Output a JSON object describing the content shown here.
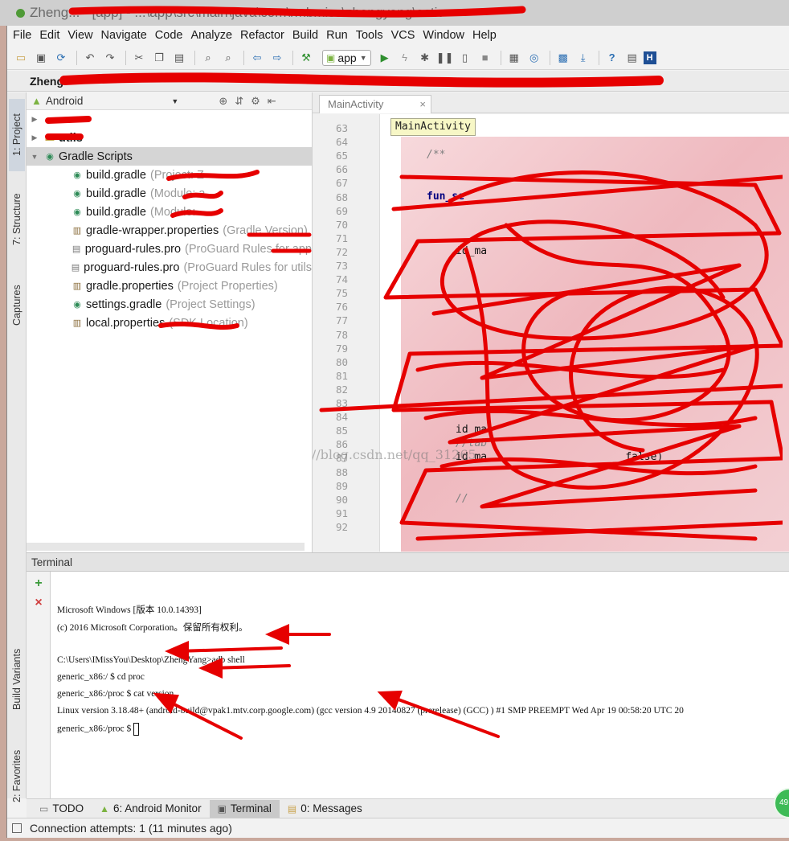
{
  "window": {
    "title": "Zheng... - [app] - ...\\app\\src\\main\\java\\com\\rmbmiss\\zhengyang\\activ"
  },
  "menubar": [
    {
      "label": "File",
      "key": "menu-file"
    },
    {
      "label": "Edit",
      "key": "menu-edit"
    },
    {
      "label": "View",
      "key": "menu-view"
    },
    {
      "label": "Navigate",
      "key": "menu-navigate"
    },
    {
      "label": "Code",
      "key": "menu-code"
    },
    {
      "label": "Analyze",
      "key": "menu-analyze"
    },
    {
      "label": "Refactor",
      "key": "menu-refactor"
    },
    {
      "label": "Build",
      "key": "menu-build"
    },
    {
      "label": "Run",
      "key": "menu-run"
    },
    {
      "label": "Tools",
      "key": "menu-tools"
    },
    {
      "label": "VCS",
      "key": "menu-vcs"
    },
    {
      "label": "Window",
      "key": "menu-window"
    },
    {
      "label": "Help",
      "key": "menu-help"
    }
  ],
  "toolbar": {
    "run_config": "app"
  },
  "navbar": {
    "project": "Zheng"
  },
  "side_tabs": {
    "project": "1: Project",
    "structure": "7: Structure",
    "captures": "Captures",
    "build_variants": "Build Variants",
    "favorites": "2: Favorites"
  },
  "project_panel": {
    "view_mode": "Android",
    "items": [
      {
        "label": "",
        "hint": "",
        "type": "folder",
        "indent": 0,
        "arrow": "▶"
      },
      {
        "label": "utils",
        "hint": "",
        "type": "folder",
        "indent": 0,
        "arrow": "▶"
      },
      {
        "label": "Gradle Scripts",
        "hint": "",
        "type": "gradle-root",
        "indent": 0,
        "arrow": "▼",
        "selected": true
      },
      {
        "label": "build.gradle",
        "hint": "(Project: Z",
        "type": "gradle",
        "indent": 1
      },
      {
        "label": "build.gradle",
        "hint": "(Module: a",
        "type": "gradle",
        "indent": 1
      },
      {
        "label": "build.gradle",
        "hint": "(Module:",
        "type": "gradle",
        "indent": 1
      },
      {
        "label": "gradle-wrapper.properties",
        "hint": "(Gradle Version)",
        "type": "props",
        "indent": 1
      },
      {
        "label": "proguard-rules.pro",
        "hint": "(ProGuard Rules for app",
        "type": "file",
        "indent": 1
      },
      {
        "label": "proguard-rules.pro",
        "hint": "(ProGuard Rules for utils",
        "type": "file",
        "indent": 1
      },
      {
        "label": "gradle.properties",
        "hint": "(Project Properties)",
        "type": "props",
        "indent": 1
      },
      {
        "label": "settings.gradle",
        "hint": "(Project Settings)",
        "type": "gradle",
        "indent": 1
      },
      {
        "label": "local.properties",
        "hint": "(SDK Location)",
        "type": "props",
        "indent": 1
      }
    ]
  },
  "editor": {
    "tab_label": "MainActivity",
    "tooltip": "MainActivity",
    "line_numbers": [
      "63",
      "64",
      "65",
      "66",
      "67",
      "68",
      "69",
      "70",
      "71",
      "72",
      "73",
      "74",
      "75",
      "76",
      "77",
      "78",
      "79",
      "80",
      "81",
      "82",
      "83",
      "84",
      "85",
      "86",
      "87",
      "88",
      "89",
      "90",
      "91",
      "92"
    ],
    "code_lines": [
      {
        "n": "63",
        "text": "}",
        "cls": ""
      },
      {
        "n": "65",
        "text": "/**",
        "cls": "cm"
      },
      {
        "n": "68",
        "text": "fun_se",
        "cls": "kw"
      },
      {
        "n": "72",
        "text": "id_ma",
        "cls": ""
      },
      {
        "n": "85",
        "text": "id_ma",
        "cls": ""
      },
      {
        "n": "86",
        "text": "//tab",
        "cls": "cm"
      },
      {
        "n": "87",
        "text": "id_ma                      false)",
        "cls": ""
      },
      {
        "n": "90",
        "text": "//",
        "cls": "cm"
      }
    ]
  },
  "terminal": {
    "title": "Terminal",
    "lines": [
      "Microsoft Windows [版本 10.0.14393]",
      "(c) 2016 Microsoft Corporation。保留所有权利。",
      "",
      "C:\\Users\\IMissYou\\Desktop\\ZhengYang>adb shell",
      "generic_x86:/ $ cd proc",
      "generic_x86:/proc $ cat version",
      "Linux version 3.18.48+ (android-build@vpak1.mtv.corp.google.com) (gcc version 4.9 20140827 (prerelease) (GCC) ) #1 SMP PREEMPT Wed Apr 19 00:58:20 UTC 20",
      "generic_x86:/proc $"
    ]
  },
  "bottom_tabs": [
    {
      "label": "TODO",
      "icon": "todo-icon"
    },
    {
      "label": "6: Android Monitor",
      "icon": "android-icon"
    },
    {
      "label": "Terminal",
      "icon": "terminal-icon",
      "active": true
    },
    {
      "label": "0: Messages",
      "icon": "messages-icon"
    }
  ],
  "statusbar": {
    "message": "Connection attempts: 1 (11 minutes ago)"
  },
  "badge": {
    "text": "49"
  },
  "watermark": "http://blog.csdn.net/qq_31265"
}
